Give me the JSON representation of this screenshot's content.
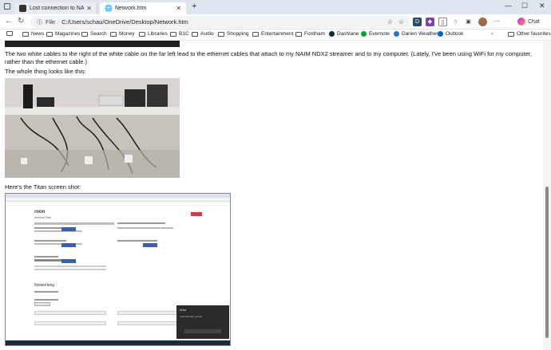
{
  "tabs": [
    {
      "label": "Lost connection to NAS server bu",
      "active": false
    },
    {
      "label": "Network.htm",
      "active": true
    }
  ],
  "address": {
    "scheme_label": "File",
    "url": "C:/Users/schau/OneDrive/Desktop/Network.htm"
  },
  "favorites": [
    "News",
    "Magazines",
    "Search",
    "Money",
    "Libraries",
    "B1C",
    "Audio",
    "Shopping",
    "Entertainment",
    "Fordham",
    "Dashlane",
    "Evernote",
    "Darien Weather",
    "Outlook"
  ],
  "other_favorites": "Other favorites",
  "chat_label": "Chat",
  "content": {
    "para1": "The two white cables to the right of the white cable on the far left lead to the ethernet cables that attach to my NAIM NDX2 streamer and to my computer.  (Lately, I've been using WiFi for my computer, rather than the ethernet cable.)",
    "para2": "The whole thing looks like this:",
    "para3": "Here's the Titan screen shot:"
  },
  "titan": {
    "brand": "roon",
    "sub": "Nucleus Titan",
    "networking": "Networking",
    "toast_title": "Drive",
    "toast_body": "Automatically synced"
  }
}
